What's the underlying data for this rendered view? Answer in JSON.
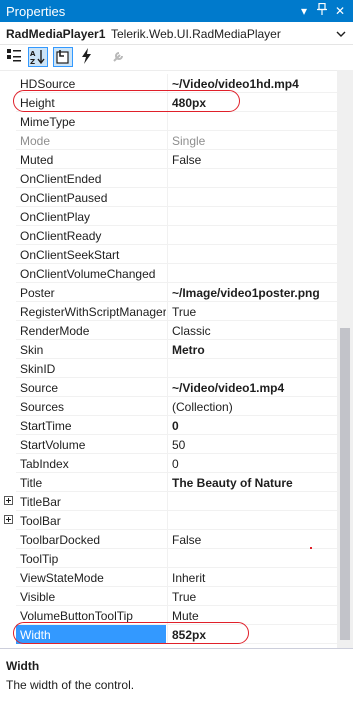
{
  "window": {
    "title": "Properties",
    "colors": {
      "accent": "#007acc",
      "selection": "#3399ff",
      "highlight": "#e0202a"
    }
  },
  "object_selector": {
    "name": "RadMediaPlayer1",
    "type": "Telerik.Web.UI.RadMediaPlayer"
  },
  "toolbar": {
    "buttons": [
      {
        "icon": "categorized-icon",
        "pressed": false
      },
      {
        "icon": "alphabetical-icon",
        "pressed": true
      },
      {
        "icon": "properties-icon",
        "pressed": true
      },
      {
        "icon": "events-icon",
        "pressed": false
      },
      {
        "icon": "property-pages-icon",
        "pressed": false
      }
    ]
  },
  "properties": [
    {
      "name": "HDSource",
      "value": "~/Video/video1hd.mp4",
      "bold": true
    },
    {
      "name": "Height",
      "value": "480px",
      "bold": true
    },
    {
      "name": "MimeType",
      "value": ""
    },
    {
      "name": "Mode",
      "value": "Single",
      "disabled": true
    },
    {
      "name": "Muted",
      "value": "False"
    },
    {
      "name": "OnClientEnded",
      "value": ""
    },
    {
      "name": "OnClientPaused",
      "value": ""
    },
    {
      "name": "OnClientPlay",
      "value": ""
    },
    {
      "name": "OnClientReady",
      "value": ""
    },
    {
      "name": "OnClientSeekStart",
      "value": ""
    },
    {
      "name": "OnClientVolumeChanged",
      "value": ""
    },
    {
      "name": "Poster",
      "value": "~/Image/video1poster.png",
      "bold": true
    },
    {
      "name": "RegisterWithScriptManager",
      "value": "True"
    },
    {
      "name": "RenderMode",
      "value": "Classic"
    },
    {
      "name": "Skin",
      "value": "Metro",
      "bold": true
    },
    {
      "name": "SkinID",
      "value": ""
    },
    {
      "name": "Source",
      "value": "~/Video/video1.mp4",
      "bold": true
    },
    {
      "name": "Sources",
      "value": "(Collection)"
    },
    {
      "name": "StartTime",
      "value": "0",
      "bold": true
    },
    {
      "name": "StartVolume",
      "value": "50"
    },
    {
      "name": "TabIndex",
      "value": "0"
    },
    {
      "name": "Title",
      "value": "The Beauty of Nature",
      "bold": true
    },
    {
      "name": "TitleBar",
      "value": "",
      "expandable": true
    },
    {
      "name": "ToolBar",
      "value": "",
      "expandable": true
    },
    {
      "name": "ToolbarDocked",
      "value": "False"
    },
    {
      "name": "ToolTip",
      "value": ""
    },
    {
      "name": "ViewStateMode",
      "value": "Inherit"
    },
    {
      "name": "Visible",
      "value": "True"
    },
    {
      "name": "VolumeButtonToolTip",
      "value": "Mute"
    },
    {
      "name": "Width",
      "value": "852px",
      "bold": true,
      "selected": true
    }
  ],
  "description": {
    "title": "Width",
    "text": "The width of the control."
  }
}
